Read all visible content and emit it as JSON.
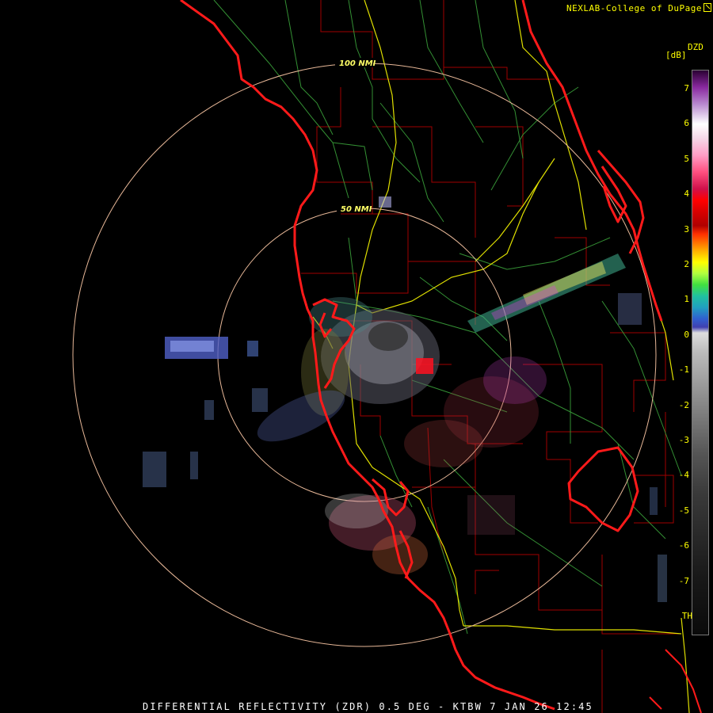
{
  "credit": "NEXLAB-College of DuPage",
  "legend": {
    "product": "DZD",
    "unit": "[dB]",
    "ticks": [
      "7",
      "6",
      "5",
      "4",
      "3",
      "2",
      "1",
      "0",
      "-1",
      "-2",
      "-3",
      "-4",
      "-5",
      "-6",
      "-7",
      "TH"
    ]
  },
  "rings": {
    "inner_label": "50 NMI",
    "outer_label": "100 NMI"
  },
  "caption": "DIFFERENTIAL REFLECTIVITY (ZDR) 0.5 DEG - KTBW 7 JAN 26 12:45",
  "colors": {
    "label_text": "#ffff00",
    "coastline": "#ff1a1a",
    "county_lines": "#a00000",
    "highways": "#e0e000",
    "roads": "#3aa03a",
    "range_rings": "#e8b898"
  }
}
